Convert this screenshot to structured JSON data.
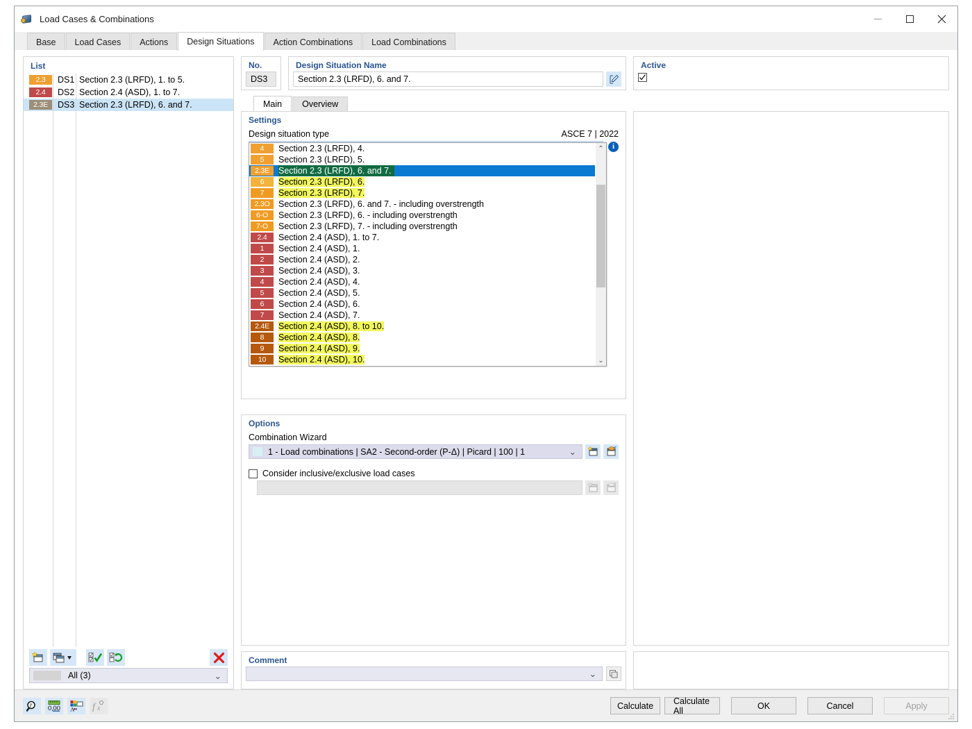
{
  "window": {
    "title": "Load Cases & Combinations",
    "icon": "app-icon",
    "minimize": "−",
    "maximize": "□",
    "close": "✕"
  },
  "tabs": [
    {
      "label": "Base",
      "active": false
    },
    {
      "label": "Load Cases",
      "active": false
    },
    {
      "label": "Actions",
      "active": false
    },
    {
      "label": "Design Situations",
      "active": true
    },
    {
      "label": "Action Combinations",
      "active": false
    },
    {
      "label": "Load Combinations",
      "active": false
    }
  ],
  "list": {
    "title": "List",
    "rows": [
      {
        "badge": "2.3",
        "badge_color": "#f0a030",
        "no": "DS1",
        "name": "Section 2.3 (LRFD), 1. to 5.",
        "selected": false
      },
      {
        "badge": "2.4",
        "badge_color": "#c04a4a",
        "no": "DS2",
        "name": "Section 2.4 (ASD), 1. to 7.",
        "selected": false
      },
      {
        "badge": "2.3E",
        "badge_color": "#9c8e78",
        "no": "DS3",
        "name": "Section 2.3 (LRFD), 6. and 7.",
        "selected": true
      }
    ],
    "toolbar": [
      {
        "name": "new-button",
        "icon": "new-window-icon"
      },
      {
        "name": "copy-dropdown-button",
        "icon": "copy-window-icon"
      },
      {
        "name": "select-all-button",
        "icon": "check-all-icon"
      },
      {
        "name": "invert-selection-button",
        "icon": "invert-selection-icon"
      },
      {
        "name": "delete-button",
        "icon": "delete-x-icon"
      }
    ],
    "filter": {
      "label": "All (3)"
    }
  },
  "header": {
    "no_label": "No.",
    "no_value": "DS3",
    "name_label": "Design Situation Name",
    "name_value": "Section 2.3 (LRFD), 6. and 7.",
    "name_edit_icon": "edit-pencil-icon",
    "active_label": "Active",
    "active_checked": "✓"
  },
  "inner_tabs": [
    {
      "label": "Main",
      "active": true
    },
    {
      "label": "Overview",
      "active": false
    }
  ],
  "settings": {
    "title": "Settings",
    "type_label": "Design situation type",
    "standard": "ASCE 7 | 2022",
    "selected_badge": "2.3E",
    "selected_badge_color": "#f0a030",
    "selected_text": "Section 2.3 (LRFD), 6. and 7.",
    "info_icon": "info-icon",
    "dropdown_items": [
      {
        "badge": "4",
        "color": "#f0a030",
        "text": "Section 2.3 (LRFD), 4.",
        "state": "normal"
      },
      {
        "badge": "5",
        "color": "#f0a030",
        "text": "Section 2.3 (LRFD), 5.",
        "state": "normal"
      },
      {
        "badge": "2.3E",
        "color": "#f0a030",
        "text": "Section 2.3 (LRFD), 6. and 7.",
        "state": "selected"
      },
      {
        "badge": "6",
        "color": "#f2b33c",
        "text": "Section 2.3 (LRFD), 6.",
        "state": "highlight"
      },
      {
        "badge": "7",
        "color": "#ef9b22",
        "text": "Section 2.3 (LRFD), 7.",
        "state": "highlight"
      },
      {
        "badge": "2.3O",
        "color": "#ef9b22",
        "text": "Section 2.3 (LRFD), 6. and 7. - including overstrength",
        "state": "normal"
      },
      {
        "badge": "6-O",
        "color": "#ef9b22",
        "text": "Section 2.3 (LRFD), 6. - including overstrength",
        "state": "normal"
      },
      {
        "badge": "7-O",
        "color": "#ef9b22",
        "text": "Section 2.3 (LRFD), 7. - including overstrength",
        "state": "normal"
      },
      {
        "badge": "2.4",
        "color": "#c04a4a",
        "text": "Section 2.4 (ASD), 1. to 7.",
        "state": "normal"
      },
      {
        "badge": "1",
        "color": "#c04a4a",
        "text": "Section 2.4 (ASD), 1.",
        "state": "normal"
      },
      {
        "badge": "2",
        "color": "#c04a4a",
        "text": "Section 2.4 (ASD), 2.",
        "state": "normal"
      },
      {
        "badge": "3",
        "color": "#c04a4a",
        "text": "Section 2.4 (ASD), 3.",
        "state": "normal"
      },
      {
        "badge": "4",
        "color": "#c04a4a",
        "text": "Section 2.4 (ASD), 4.",
        "state": "normal"
      },
      {
        "badge": "5",
        "color": "#c04a4a",
        "text": "Section 2.4 (ASD), 5.",
        "state": "normal"
      },
      {
        "badge": "6",
        "color": "#c04a4a",
        "text": "Section 2.4 (ASD), 6.",
        "state": "normal"
      },
      {
        "badge": "7",
        "color": "#c04a4a",
        "text": "Section 2.4 (ASD), 7.",
        "state": "normal"
      },
      {
        "badge": "2.4E",
        "color": "#b5590f",
        "text": "Section 2.4 (ASD), 8. to 10.",
        "state": "highlight"
      },
      {
        "badge": "8",
        "color": "#b5590f",
        "text": "Section 2.4 (ASD), 8.",
        "state": "highlight"
      },
      {
        "badge": "9",
        "color": "#b5590f",
        "text": "Section 2.4 (ASD), 9.",
        "state": "highlight"
      },
      {
        "badge": "10",
        "color": "#b5590f",
        "text": "Section 2.4 (ASD), 10.",
        "state": "highlight"
      }
    ]
  },
  "options": {
    "title": "Options",
    "wizard_label": "Combination Wizard",
    "wizard_value": "1 - Load combinations | SA2 - Second-order (P-Δ) | Picard | 100 | 1",
    "wizard_new_icon": "new-item-icon",
    "wizard_edit_icon": "edit-item-icon",
    "consider_label": "Consider inclusive/exclusive load cases",
    "consider_checked": false,
    "inclusive_new_icon": "new-item-icon-disabled",
    "inclusive_edit_icon": "edit-item-icon-disabled"
  },
  "comment": {
    "title": "Comment",
    "value": "",
    "button_icon": "comment-library-icon"
  },
  "footer": {
    "icons": [
      {
        "name": "find-button",
        "icon": "magnifier-icon",
        "disabled": false
      },
      {
        "name": "units-button",
        "icon": "units-ruler-icon",
        "disabled": false
      },
      {
        "name": "display-properties-button",
        "icon": "color-palette-icon",
        "disabled": false
      },
      {
        "name": "formula-button",
        "icon": "function-icon",
        "disabled": true
      }
    ],
    "buttons": [
      {
        "label": "Calculate",
        "disabled": false
      },
      {
        "label": "Calculate All",
        "disabled": false
      },
      {
        "label": "OK",
        "disabled": false
      },
      {
        "label": "Cancel",
        "disabled": false
      },
      {
        "label": "Apply",
        "disabled": true
      }
    ]
  },
  "colors": {
    "accent_blue": "#0a7ad1",
    "group_label": "#2a5590",
    "selection": "#cce4f7",
    "highlight_yellow": "#f2f75c",
    "selected_green": "#116b42"
  }
}
